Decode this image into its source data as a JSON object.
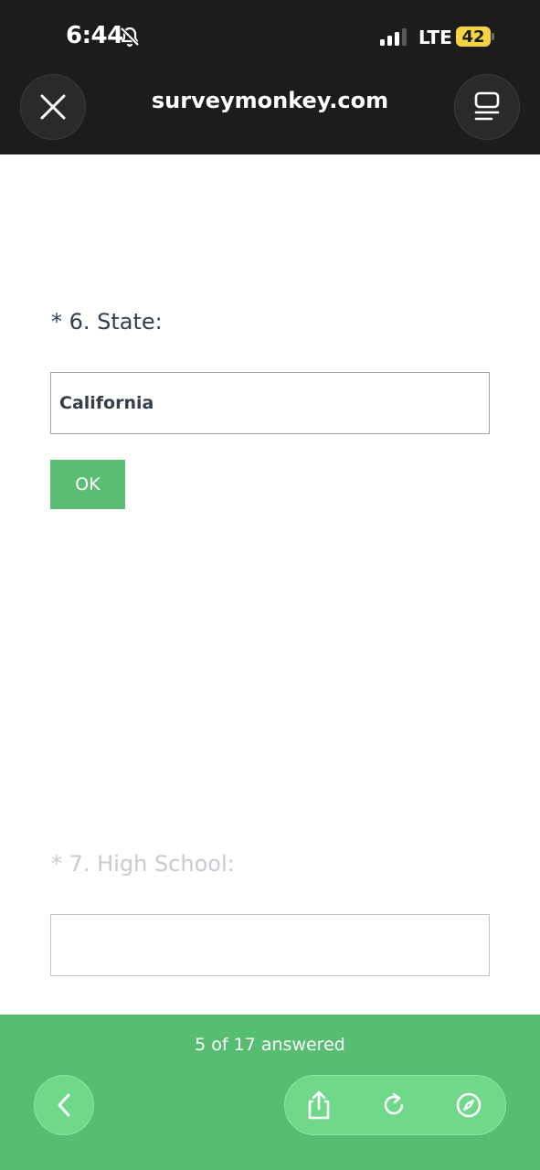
{
  "status_bar": {
    "time": "6:44",
    "network": "LTE",
    "battery": "42"
  },
  "browser": {
    "url": "surveymonkey.com",
    "close_icon": "close-icon",
    "reader_icon": "reader-icon"
  },
  "questions": [
    {
      "label": "* 6. State:",
      "value": "California",
      "active": true
    },
    {
      "label": "* 7. High School:",
      "value": "",
      "active": false
    }
  ],
  "ok_button": {
    "label": "OK"
  },
  "footer": {
    "progress": "5 of 17 answered",
    "icons": [
      "chevron-left-icon",
      "share-icon",
      "reload-icon",
      "compass-icon"
    ]
  },
  "colors": {
    "accent_green": "#56bd72",
    "ok_green": "#5bbe72",
    "text_dark": "#333e48",
    "text_faded": "#c7cbcf"
  }
}
